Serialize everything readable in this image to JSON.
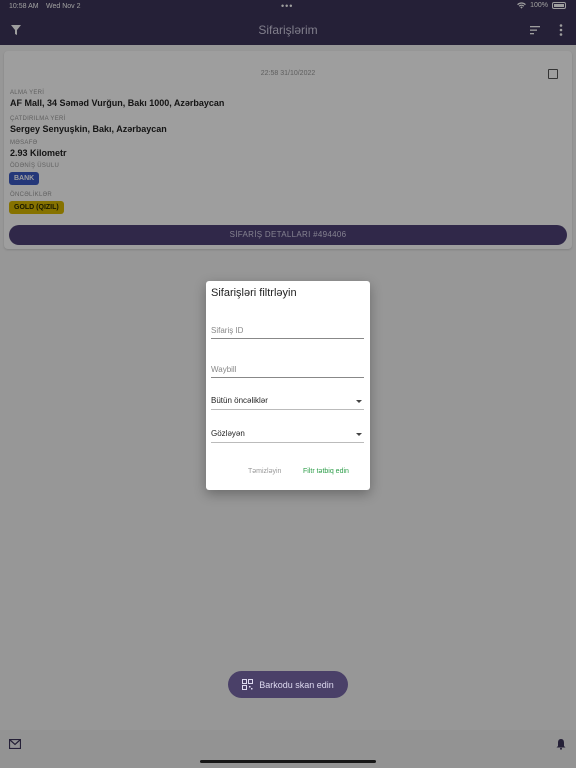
{
  "status_bar": {
    "time": "10:58 AM",
    "date": "Wed Nov 2",
    "dots": "•••",
    "battery": "100%"
  },
  "app_bar": {
    "title": "Sifarişlərim"
  },
  "order": {
    "timestamp": "22:58 31/10/2022",
    "pickup_label": "ALMA YERİ",
    "pickup_value": "AF Mall, 34 Səməd Vurğun, Bakı 1000, Azərbaycan",
    "delivery_label": "ÇATDIRILMA YERİ",
    "delivery_value": "Sergey Senyuşkin, Bakı, Azərbaycan",
    "distance_label": "MƏSAFƏ",
    "distance_value": "2.93 Kilometr",
    "payment_label": "ÖDƏNİŞ ÜSULU",
    "payment_value": "BANK",
    "priority_label": "ÖNCƏLİKLƏR",
    "priority_value": "GOLD (QIZIL)",
    "details_button": "SİFARİŞ DETALLARI #494406"
  },
  "scan_button": {
    "label": "Barkodu skan edin"
  },
  "dialog": {
    "title": "Sifarişləri filtrləyin",
    "order_id_placeholder": "Sifariş ID",
    "waybill_placeholder": "Waybill",
    "priority_select": "Bütün öncəliklər",
    "status_select": "Gözləyən",
    "clear_button": "Təmizləyin",
    "apply_button": "Filtr tətbiq edin"
  },
  "colors": {
    "app_bar": "#3d3559",
    "apply_green": "#2e9e4a",
    "bank_blue": "#3b59c4",
    "gold_yellow": "#d8b800"
  }
}
